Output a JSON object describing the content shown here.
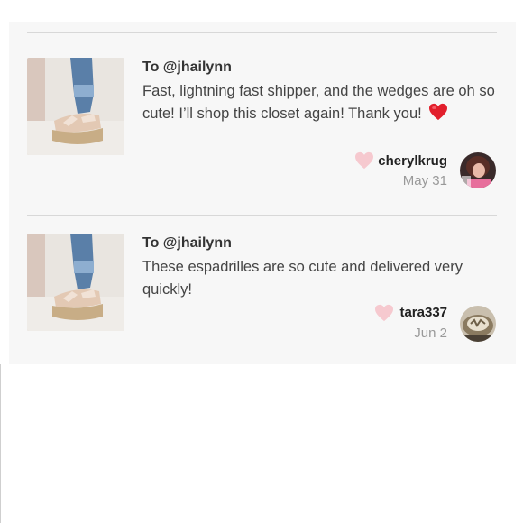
{
  "reviews": [
    {
      "to": "To @jhailynn",
      "message": "Fast, lightning fast shipper, and the wedges are oh so cute! I’ll shop this closet again! Thank you!",
      "emoji": "red-heart",
      "username": "cherylkrug",
      "date": "May 31",
      "avatar": "avatar-woman-photo"
    },
    {
      "to": "To @jhailynn",
      "message": "These espadrilles are so cute and delivered very quickly!",
      "username": "tara337",
      "date": "Jun 2",
      "avatar": "avatar-photo"
    }
  ],
  "colors": {
    "card_bg": "#f7f7f7",
    "like_heart": "#f6c9cf",
    "divider": "#d8d8d8"
  }
}
